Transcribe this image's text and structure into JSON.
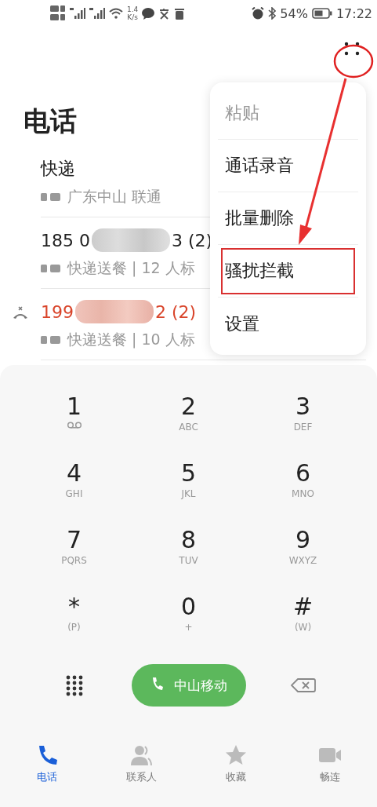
{
  "status_bar": {
    "speed_value": "1.4",
    "speed_unit": "K/s",
    "battery": "54%",
    "time": "17:22"
  },
  "header": {
    "title": "电话",
    "more_annotated": true
  },
  "calls": [
    {
      "name_parts": [
        "快递"
      ],
      "detail": "广东中山 联通",
      "missed": false,
      "redacted": false
    },
    {
      "name_parts": [
        "185 0",
        "3 (2)"
      ],
      "detail": "快递送餐 | 12 人标",
      "missed": false,
      "redacted": true
    },
    {
      "name_parts": [
        "199",
        "2 (2)"
      ],
      "detail": "快递送餐 | 10 人标",
      "missed": true,
      "redacted": true
    }
  ],
  "menu": [
    {
      "label": "粘贴",
      "disabled": true,
      "highlighted": false
    },
    {
      "label": "通话录音",
      "disabled": false,
      "highlighted": false
    },
    {
      "label": "批量删除",
      "disabled": false,
      "highlighted": false
    },
    {
      "label": "骚扰拦截",
      "disabled": false,
      "highlighted": true
    },
    {
      "label": "设置",
      "disabled": false,
      "highlighted": false
    }
  ],
  "keypad": [
    {
      "digit": "1",
      "kind": "voicemail"
    },
    {
      "digit": "2",
      "letters": "ABC",
      "kind": "letters"
    },
    {
      "digit": "3",
      "letters": "DEF",
      "kind": "letters"
    },
    {
      "digit": "4",
      "letters": "GHI",
      "kind": "letters"
    },
    {
      "digit": "5",
      "letters": "JKL",
      "kind": "letters"
    },
    {
      "digit": "6",
      "letters": "MNO",
      "kind": "letters"
    },
    {
      "digit": "7",
      "letters": "PQRS",
      "kind": "letters"
    },
    {
      "digit": "8",
      "letters": "TUV",
      "kind": "letters"
    },
    {
      "digit": "9",
      "letters": "WXYZ",
      "kind": "letters"
    },
    {
      "digit": "*",
      "letters": "(P)",
      "kind": "letters"
    },
    {
      "digit": "0",
      "letters": "+",
      "kind": "letters"
    },
    {
      "digit": "#",
      "letters": "(W)",
      "kind": "letters"
    }
  ],
  "call_button": {
    "label": "中山移动"
  },
  "tabs": [
    {
      "label": "电话",
      "kind": "phone",
      "selected": true
    },
    {
      "label": "联系人",
      "kind": "contacts",
      "selected": false
    },
    {
      "label": "收藏",
      "kind": "favorites",
      "selected": false
    },
    {
      "label": "畅连",
      "kind": "video",
      "selected": false
    }
  ]
}
